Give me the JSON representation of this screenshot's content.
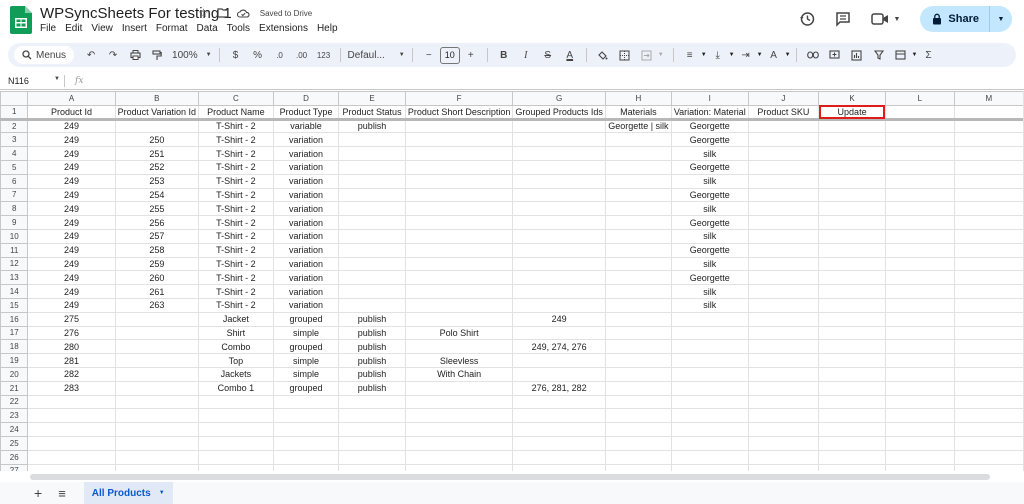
{
  "doc": {
    "title": "WPSyncSheets For testing 1",
    "saved_status": "Saved to Drive"
  },
  "menu": [
    "File",
    "Edit",
    "View",
    "Insert",
    "Format",
    "Data",
    "Tools",
    "Extensions",
    "Help"
  ],
  "share": {
    "label": "Share"
  },
  "toolbar": {
    "menus_label": "Menus",
    "zoom": "100%",
    "currency": "$",
    "percent": "%",
    "decrease_decimal": ".0",
    "increase_decimal": ".00",
    "number_format": "123",
    "font": "Defaul...",
    "font_size": "10",
    "bold": "B",
    "italic": "I",
    "text_color": "A"
  },
  "formula_bar": {
    "cell_ref": "N116",
    "fx": "fx",
    "content": ""
  },
  "grid": {
    "columns": [
      "A",
      "B",
      "C",
      "D",
      "E",
      "F",
      "G",
      "H",
      "I",
      "J",
      "K",
      "L",
      "M"
    ],
    "headers": [
      "Product Id",
      "Product Variation Id",
      "Product Name",
      "Product Type",
      "Product Status",
      "Product Short Description",
      "Grouped Products Ids",
      "Materials",
      "Variation: Material",
      "Product SKU",
      "Update",
      "",
      ""
    ],
    "rows": [
      [
        "249",
        "",
        "T-Shirt - 2",
        "variable",
        "publish",
        "",
        "",
        "Georgette | silk",
        "Georgette",
        "",
        "",
        "",
        ""
      ],
      [
        "249",
        "250",
        "T-Shirt - 2",
        "variation",
        "",
        "",
        "",
        "",
        "Georgette",
        "",
        "",
        "",
        ""
      ],
      [
        "249",
        "251",
        "T-Shirt - 2",
        "variation",
        "",
        "",
        "",
        "",
        "silk",
        "",
        "",
        "",
        ""
      ],
      [
        "249",
        "252",
        "T-Shirt - 2",
        "variation",
        "",
        "",
        "",
        "",
        "Georgette",
        "",
        "",
        "",
        ""
      ],
      [
        "249",
        "253",
        "T-Shirt - 2",
        "variation",
        "",
        "",
        "",
        "",
        "silk",
        "",
        "",
        "",
        ""
      ],
      [
        "249",
        "254",
        "T-Shirt - 2",
        "variation",
        "",
        "",
        "",
        "",
        "Georgette",
        "",
        "",
        "",
        ""
      ],
      [
        "249",
        "255",
        "T-Shirt - 2",
        "variation",
        "",
        "",
        "",
        "",
        "silk",
        "",
        "",
        "",
        ""
      ],
      [
        "249",
        "256",
        "T-Shirt - 2",
        "variation",
        "",
        "",
        "",
        "",
        "Georgette",
        "",
        "",
        "",
        ""
      ],
      [
        "249",
        "257",
        "T-Shirt - 2",
        "variation",
        "",
        "",
        "",
        "",
        "silk",
        "",
        "",
        "",
        ""
      ],
      [
        "249",
        "258",
        "T-Shirt - 2",
        "variation",
        "",
        "",
        "",
        "",
        "Georgette",
        "",
        "",
        "",
        ""
      ],
      [
        "249",
        "259",
        "T-Shirt - 2",
        "variation",
        "",
        "",
        "",
        "",
        "silk",
        "",
        "",
        "",
        ""
      ],
      [
        "249",
        "260",
        "T-Shirt - 2",
        "variation",
        "",
        "",
        "",
        "",
        "Georgette",
        "",
        "",
        "",
        ""
      ],
      [
        "249",
        "261",
        "T-Shirt - 2",
        "variation",
        "",
        "",
        "",
        "",
        "silk",
        "",
        "",
        "",
        ""
      ],
      [
        "249",
        "263",
        "T-Shirt - 2",
        "variation",
        "",
        "",
        "",
        "",
        "silk",
        "",
        "",
        "",
        ""
      ],
      [
        "275",
        "",
        "Jacket",
        "grouped",
        "publish",
        "",
        "249",
        "",
        "",
        "",
        "",
        "",
        ""
      ],
      [
        "276",
        "",
        "Shirt",
        "simple",
        "publish",
        "Polo Shirt",
        "",
        "",
        "",
        "",
        "",
        "",
        ""
      ],
      [
        "280",
        "",
        "Combo",
        "grouped",
        "publish",
        "",
        "249, 274, 276",
        "",
        "",
        "",
        "",
        "",
        ""
      ],
      [
        "281",
        "",
        "Top",
        "simple",
        "publish",
        "Sleevless",
        "",
        "",
        "",
        "",
        "",
        "",
        ""
      ],
      [
        "282",
        "",
        "Jackets",
        "simple",
        "publish",
        "With Chain",
        "",
        "",
        "",
        "",
        "",
        "",
        ""
      ],
      [
        "283",
        "",
        "Combo 1",
        "grouped",
        "publish",
        "",
        "276, 281, 282",
        "",
        "",
        "",
        "",
        "",
        ""
      ],
      [
        "",
        "",
        "",
        "",
        "",
        "",
        "",
        "",
        "",
        "",
        "",
        "",
        ""
      ],
      [
        "",
        "",
        "",
        "",
        "",
        "",
        "",
        "",
        "",
        "",
        "",
        "",
        ""
      ],
      [
        "",
        "",
        "",
        "",
        "",
        "",
        "",
        "",
        "",
        "",
        "",
        "",
        ""
      ],
      [
        "",
        "",
        "",
        "",
        "",
        "",
        "",
        "",
        "",
        "",
        "",
        "",
        ""
      ],
      [
        "",
        "",
        "",
        "",
        "",
        "",
        "",
        "",
        "",
        "",
        "",
        "",
        ""
      ],
      [
        "",
        "",
        "",
        "",
        "",
        "",
        "",
        "",
        "",
        "",
        "",
        "",
        ""
      ]
    ],
    "selected_header": "K1"
  },
  "sheets": [
    {
      "name": "All Products"
    }
  ]
}
